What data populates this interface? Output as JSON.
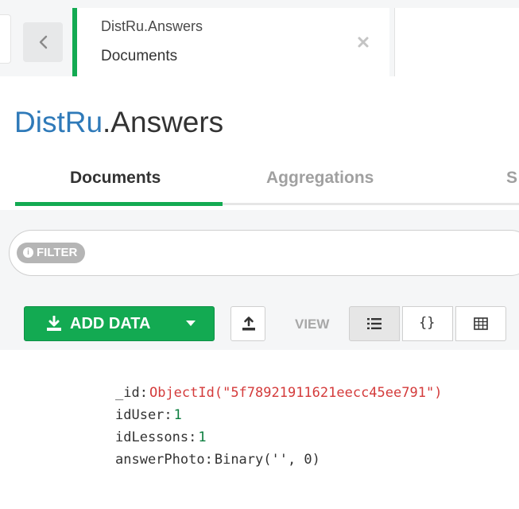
{
  "tab": {
    "namespace": "DistRu.Answers",
    "subtitle": "Documents"
  },
  "title": {
    "db": "DistRu",
    "collection": ".Answers"
  },
  "subtabs": [
    {
      "label": "Documents",
      "active": true
    },
    {
      "label": "Aggregations",
      "active": false
    },
    {
      "label": "S",
      "active": false
    }
  ],
  "filter": {
    "label": "FILTER"
  },
  "toolbar": {
    "add_data_label": "ADD DATA",
    "view_label": "VIEW",
    "json_view_glyph": "{}"
  },
  "document": {
    "fields": [
      {
        "key": "_id",
        "value": "ObjectId(\"5f78921911621eecc45ee791\")",
        "type": "objectid"
      },
      {
        "key": "idUser",
        "value": "1",
        "type": "number"
      },
      {
        "key": "idLessons",
        "value": "1",
        "type": "number"
      },
      {
        "key": "answerPhoto",
        "value": "Binary('', 0)",
        "type": "binary"
      }
    ]
  },
  "colors": {
    "accent": "#13aa52",
    "db_name": "#2f7ab9",
    "objectid": "#d43b3b",
    "number": "#0b7d3e"
  },
  "icons": {
    "back": "chevron-left-icon",
    "close": "close-icon",
    "add_data": "download-icon",
    "dropdown": "caret-down-icon",
    "export": "upload-icon",
    "list_view": "list-view-icon",
    "json_view": "json-view-icon",
    "table_view": "table-view-icon",
    "info": "info-icon"
  }
}
